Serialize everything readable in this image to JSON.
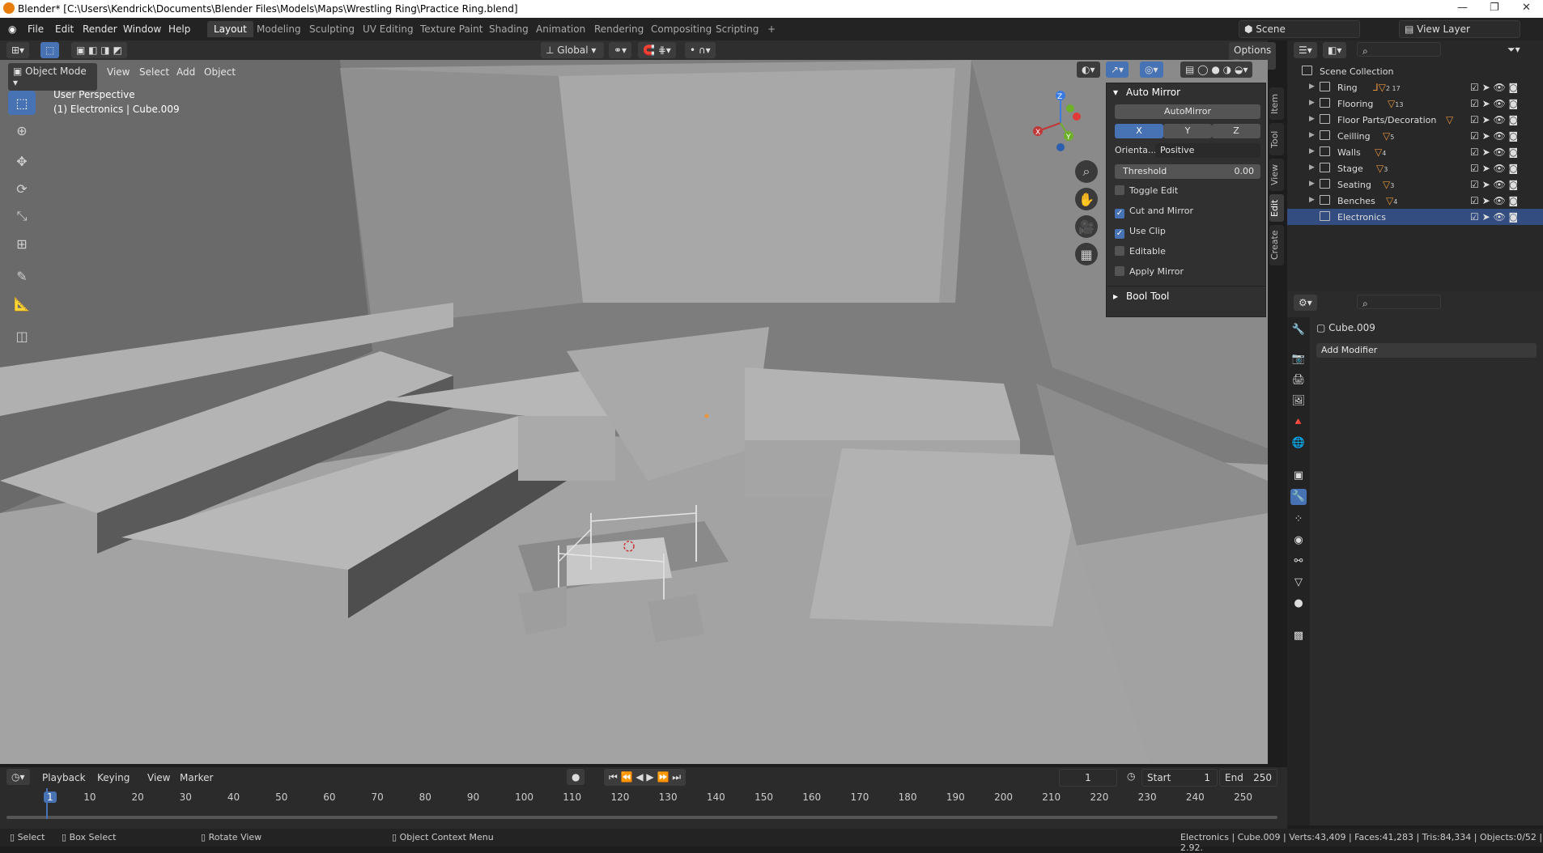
{
  "window": {
    "title": "Blender* [C:\\Users\\Kendrick\\Documents\\Blender Files\\Models\\Maps\\Wrestling Ring\\Practice Ring.blend]",
    "minimize": "—",
    "restore": "❐",
    "close": "✕"
  },
  "menu": [
    "File",
    "Edit",
    "Render",
    "Window",
    "Help"
  ],
  "workspace_tabs": [
    "Layout",
    "Modeling",
    "Sculpting",
    "UV Editing",
    "Texture Paint",
    "Shading",
    "Animation",
    "Rendering",
    "Compositing",
    "Scripting"
  ],
  "workspace_add": "+",
  "scene": "Scene",
  "view_layer": "View Layer",
  "viewport_header": {
    "orientation": "Global",
    "options": "Options",
    "mode": "Object Mode",
    "menus": [
      "View",
      "Select",
      "Add",
      "Object"
    ]
  },
  "overlay_text": {
    "perspective": "User Perspective",
    "object": "(1) Electronics | Cube.009"
  },
  "gizmo": {
    "x": "X",
    "y": "Y",
    "z": "Z"
  },
  "auto_mirror_panel": {
    "title": "Auto Mirror",
    "button": "AutoMirror",
    "axes": [
      "X",
      "Y",
      "Z"
    ],
    "orientation_label": "Orienta...",
    "orientation_value": "Positive",
    "threshold_label": "Threshold",
    "threshold_value": "0.00",
    "options": [
      {
        "label": "Toggle Edit",
        "checked": false
      },
      {
        "label": "Cut and Mirror",
        "checked": true
      },
      {
        "label": "Use Clip",
        "checked": true
      },
      {
        "label": "Editable",
        "checked": false
      },
      {
        "label": "Apply Mirror",
        "checked": false
      }
    ],
    "bool_tool": "Bool Tool"
  },
  "side_tabs": [
    "Item",
    "Tool",
    "View",
    "Edit",
    "Create"
  ],
  "outliner": {
    "root": "Scene Collection",
    "items": [
      {
        "name": "Ring",
        "badge": "2  17"
      },
      {
        "name": "Flooring",
        "badge": "13"
      },
      {
        "name": "Floor Parts/Decoration",
        "badge": ""
      },
      {
        "name": "Ceilling",
        "badge": "5"
      },
      {
        "name": "Walls",
        "badge": "4"
      },
      {
        "name": "Stage",
        "badge": "3"
      },
      {
        "name": "Seating",
        "badge": "3"
      },
      {
        "name": "Benches",
        "badge": "4"
      },
      {
        "name": "Electronics",
        "badge": ""
      }
    ]
  },
  "properties": {
    "object_name": "Cube.009",
    "add_modifier": "Add Modifier"
  },
  "timeline": {
    "menus": [
      "Playback",
      "Keying",
      "View",
      "Marker"
    ],
    "current_frame": "1",
    "start_label": "Start",
    "start": "1",
    "end_label": "End",
    "end": "250",
    "ticks": [
      "1",
      "10",
      "20",
      "30",
      "40",
      "50",
      "60",
      "70",
      "80",
      "90",
      "100",
      "110",
      "120",
      "130",
      "140",
      "150",
      "160",
      "170",
      "180",
      "190",
      "200",
      "210",
      "220",
      "230",
      "240",
      "250"
    ]
  },
  "status": {
    "select": "Select",
    "box_select": "Box Select",
    "rotate_view": "Rotate View",
    "context_menu": "Object Context Menu",
    "stats": "Electronics | Cube.009 | Verts:43,409 | Faces:41,283 | Tris:84,334 | Objects:0/52 | 2.92."
  },
  "colors": {
    "accent": "#4772b3",
    "selection_row": "#334d80",
    "collection_icon": "#e8963b",
    "viewport_bg": "#7f7f7f"
  }
}
